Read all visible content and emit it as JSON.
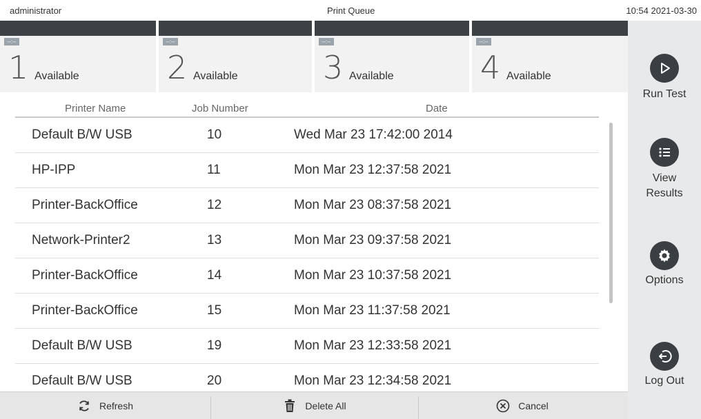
{
  "topbar": {
    "user": "administrator",
    "title": "Print Queue",
    "datetime": "10:54 2021-03-30"
  },
  "modules": [
    {
      "number": "1",
      "status": "Available",
      "indicator": "--:--"
    },
    {
      "number": "2",
      "status": "Available",
      "indicator": "--:--"
    },
    {
      "number": "3",
      "status": "Available",
      "indicator": "--:--"
    },
    {
      "number": "4",
      "status": "Available",
      "indicator": "--:--"
    }
  ],
  "sidebar": {
    "run_test": "Run Test",
    "view_results": "View Results",
    "options": "Options",
    "log_out": "Log Out"
  },
  "table": {
    "columns": [
      "Printer Name",
      "Job Number",
      "Date"
    ],
    "rows": [
      {
        "printer": "Default B/W USB",
        "job": "10",
        "date": "Wed Mar 23 17:42:00 2014"
      },
      {
        "printer": "HP-IPP",
        "job": "11",
        "date": "Mon Mar 23 12:37:58 2021"
      },
      {
        "printer": "Printer-BackOffice",
        "job": "12",
        "date": "Mon Mar 23 08:37:58 2021"
      },
      {
        "printer": "Network-Printer2",
        "job": "13",
        "date": "Mon Mar 23 09:37:58 2021"
      },
      {
        "printer": "Printer-BackOffice",
        "job": "14",
        "date": "Mon Mar 23 10:37:58 2021"
      },
      {
        "printer": "Printer-BackOffice",
        "job": "15",
        "date": "Mon Mar 23 11:37:58 2021"
      },
      {
        "printer": "Default B/W USB",
        "job": "19",
        "date": "Mon Mar 23 12:33:58 2021"
      },
      {
        "printer": "Default B/W USB",
        "job": "20",
        "date": "Mon Mar 23 12:34:58 2021"
      }
    ]
  },
  "bottombar": {
    "refresh": "Refresh",
    "delete_all": "Delete All",
    "cancel": "Cancel"
  },
  "icons": {
    "run_test": "play-icon",
    "view_results": "list-icon",
    "options": "gear-icon",
    "log_out": "logout-icon",
    "refresh": "refresh-icon",
    "delete_all": "trash-icon",
    "cancel": "cancel-icon"
  },
  "colors": {
    "sidebar_bg": "#e8e9ea",
    "icon_circle": "#3a3f44",
    "module_strip": "#3c4146"
  }
}
